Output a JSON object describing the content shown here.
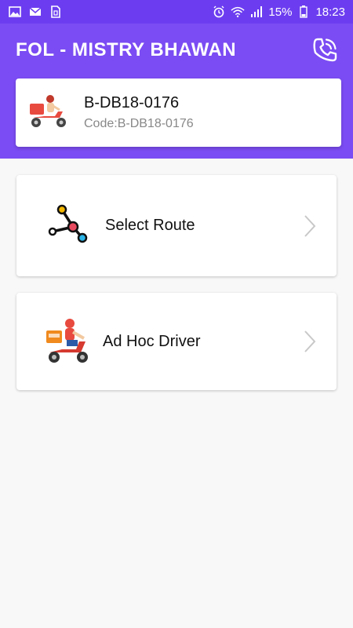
{
  "status_bar": {
    "left_icons": [
      "gallery-icon",
      "mail-icon",
      "sim-icon"
    ],
    "right_icons": [
      "alarm-icon",
      "wifi-icon",
      "signal-icon",
      "battery-icon"
    ],
    "battery": "15%",
    "time": "18:23"
  },
  "header": {
    "title": "FOL - MISTRY BHAWAN",
    "call_icon": "phone-call-icon"
  },
  "vehicle": {
    "number": "B-DB18-0176",
    "code": "Code:B-DB18-0176",
    "icon": "delivery-scooter-icon"
  },
  "menu": [
    {
      "label": "Select Route",
      "icon": "route-nodes-icon"
    },
    {
      "label": "Ad Hoc Driver",
      "icon": "delivery-rider-icon"
    }
  ],
  "colors": {
    "status_bar": "#6c3df0",
    "header": "#7b4cf3",
    "background": "#f8f8f8"
  }
}
